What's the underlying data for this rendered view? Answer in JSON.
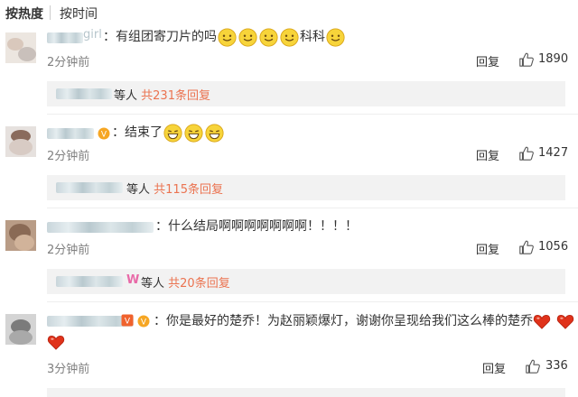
{
  "sort": {
    "hot_label": "按热度",
    "time_label": "按时间"
  },
  "comments": [
    {
      "name_visible": "girl",
      "text_prefix": "：有组团寄刀片的吗",
      "text_suffix": "科科",
      "time": "2分钟前",
      "reply_label": "回复",
      "likes": "1890",
      "replies_suffix": "等人",
      "replies_link": "共231条回复"
    },
    {
      "text": "：结束了",
      "time": "2分钟前",
      "reply_label": "回复",
      "likes": "1427",
      "replies_suffix": "等人",
      "replies_link": "共115条回复"
    },
    {
      "text": "：什么结局啊啊啊啊啊啊啊！！！！",
      "time": "2分钟前",
      "reply_label": "回复",
      "likes": "1056",
      "replies_badge": "W",
      "replies_suffix": "等人",
      "replies_link": "共20条回复"
    },
    {
      "text": "：你是最好的楚乔！为赵丽颖爆灯，谢谢你呈现给我们这么棒的楚乔",
      "time": "3分钟前",
      "reply_label": "回复",
      "likes": "336"
    }
  ],
  "icons": {
    "emoji": "smile-emoji-icon",
    "grin": "grin-emoji-icon",
    "heart": "heart-icon",
    "like": "thumbs-up-icon",
    "vip": "vip-badge-icon"
  },
  "colors": {
    "link": "#eb7350",
    "time": "#808080",
    "reply_bg": "#f2f2f2"
  }
}
